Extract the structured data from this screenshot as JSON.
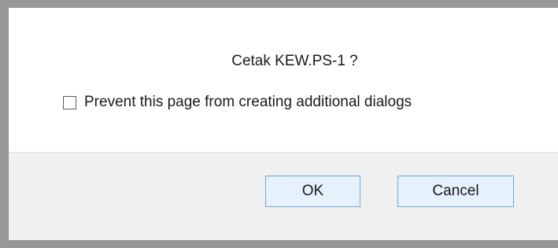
{
  "dialog": {
    "message": "Cetak KEW.PS-1 ?",
    "prevent_checkbox": {
      "label": "Prevent this page from creating additional dialogs",
      "checked": false
    },
    "buttons": {
      "ok_label": "OK",
      "cancel_label": "Cancel"
    }
  },
  "colors": {
    "backdrop": "#979797",
    "dialog_bg": "#ffffff",
    "footer_bg": "#f0f0f0",
    "button_bg": "#e5f1fb",
    "button_border": "#6ea8dd"
  }
}
